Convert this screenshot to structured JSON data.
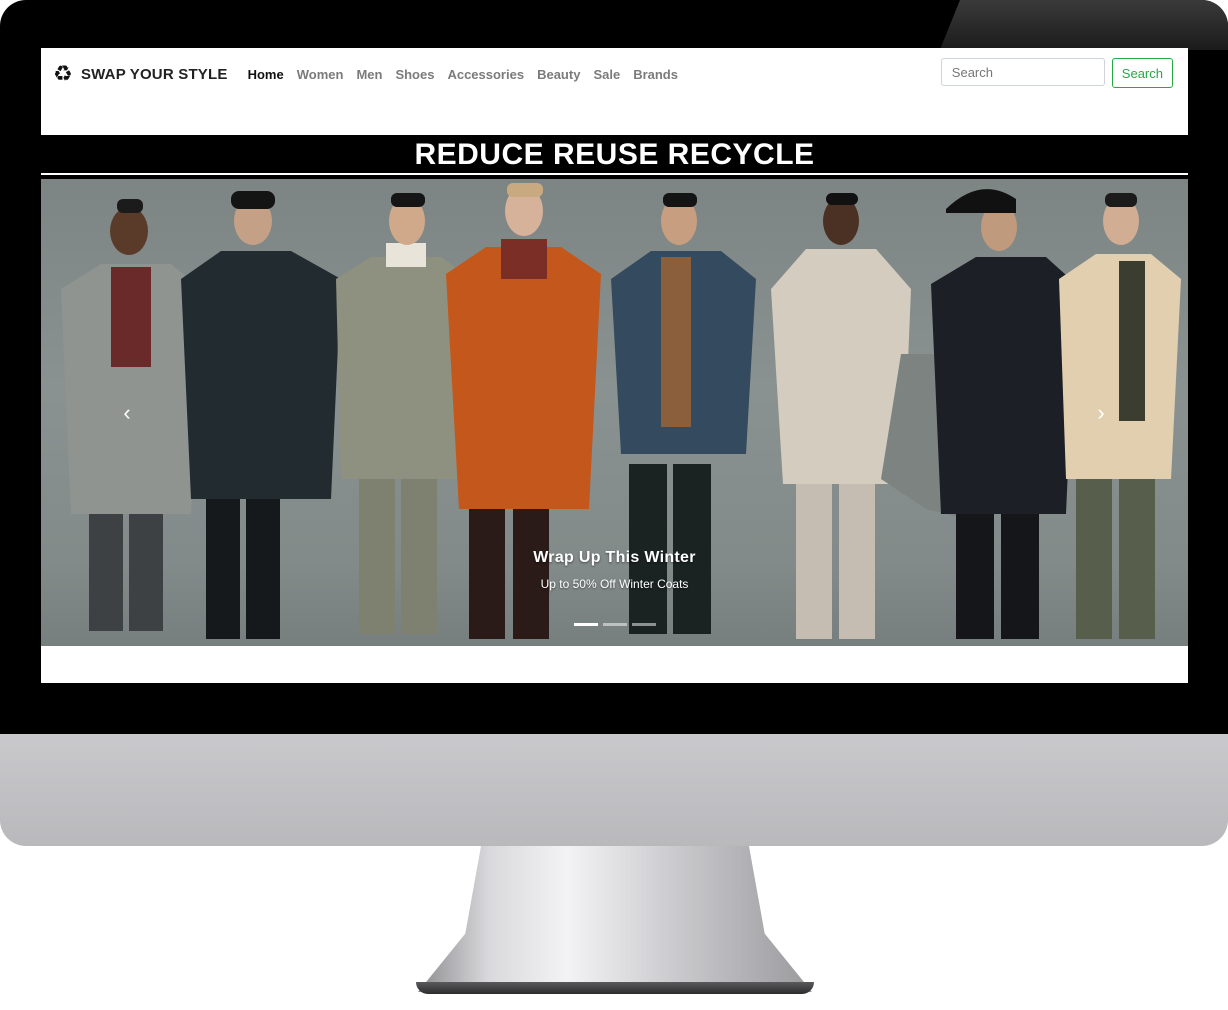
{
  "header": {
    "brand_name": "SWAP YOUR STYLE",
    "brand_icon": "recycle-icon"
  },
  "nav": {
    "items": [
      {
        "label": "Home",
        "active": true
      },
      {
        "label": "Women",
        "active": false
      },
      {
        "label": "Men",
        "active": false
      },
      {
        "label": "Shoes",
        "active": false
      },
      {
        "label": "Accessories",
        "active": false
      },
      {
        "label": "Beauty",
        "active": false
      },
      {
        "label": "Sale",
        "active": false
      },
      {
        "label": "Brands",
        "active": false
      }
    ]
  },
  "search": {
    "placeholder": "Search",
    "value": "",
    "button_label": "Search"
  },
  "banner": {
    "text": "REDUCE REUSE RECYCLE"
  },
  "carousel": {
    "slide_title": "Wrap Up This Winter",
    "slide_text": "Up to 50% Off Winter Coats",
    "prev_icon": "chevron-left-icon",
    "next_icon": "chevron-right-icon",
    "slide_count": 3,
    "active_index": 0
  },
  "colors": {
    "accent_green": "#28a745",
    "banner_bg": "#000000",
    "text_dark": "#222222",
    "nav_muted": "#7b7b7b"
  }
}
